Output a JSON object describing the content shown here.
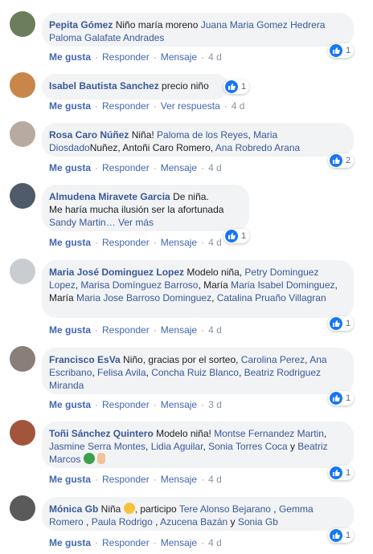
{
  "labels": {
    "like": "Me gusta",
    "reply": "Responder",
    "message": "Mensaje",
    "view_reply": "Ver respuesta",
    "sep": "·"
  },
  "comments": [
    {
      "author": "Pepita Gómez",
      "text": " Niño maría moreno ",
      "tags": [
        "Juana Maria Gomez Hedrera",
        "Paloma Galafate Andrades"
      ],
      "time": "4 d",
      "reactions": "1",
      "avatar_color": "#6b7d5a"
    },
    {
      "author": "Isabel Bautista Sanchez",
      "text": " precio niño",
      "time": "4 d",
      "reactions": "1",
      "avatar_color": "#c8864a"
    },
    {
      "author": "Rosa Caro Núñez",
      "text_a": " Niña! ",
      "tag_a": "Paloma de los Reyes",
      "text_b": ", ",
      "tag_b": "Maria Diosdado",
      "text_c": "Nuñez, Antoñi Caro Romero, ",
      "tag_c": "Ana Robredo Arana",
      "time": "4 d",
      "reactions": "2",
      "avatar_color": "#b7aaa0"
    },
    {
      "author": "Almudena Miravete Garcia",
      "text": " De niña.",
      "line2": "Me haría mucha ilusión ser la afortunada",
      "tag": "Sandy Martin",
      "more": "… Ver más",
      "time": "4 d",
      "reactions": "1",
      "avatar_color": "#4f5a6a"
    },
    {
      "author": "Maria José Dominguez Lopez",
      "text_a": " Modelo niña, ",
      "tag_a": "Petry Dominguez Lopez",
      "text_b": ", ",
      "tag_b": "Marisa Domínguez Barroso",
      "text_c": ", María ",
      "tag_c": "Maria Isabel Dominguez",
      "text_d": ", María ",
      "tag_d": "Maria Jose Barroso Dominguez",
      "text_e": ", ",
      "tag_e": "Catalina Pruaño Villagran",
      "time": "4 d",
      "reactions": "1",
      "avatar_color": "#c9ccd1"
    },
    {
      "author": "Francisco EsVa",
      "text_a": " Niño, gracias por el sorteo, ",
      "tag_a": "Carolina Perez",
      "text_b": ", ",
      "tag_b": "Ana Escribano",
      "text_c": ", ",
      "tag_c": "Felisa Avila",
      "text_d": ", ",
      "tag_d": "Concha Ruiz Blanco",
      "text_e": ", ",
      "tag_e": "Beatriz Rodriguez Miranda",
      "time": "3 d",
      "reactions": "1",
      "avatar_color": "#8a7f78"
    },
    {
      "author": "Toñi Sánchez Quintero",
      "text_a": " Modelo niña! ",
      "tag_a": "Montse Fernandez Martin",
      "text_b": ", ",
      "tag_b": "Jasmine Serra Montes",
      "text_c": ", ",
      "tag_c": "Lidia Aguilar",
      "text_d": ", ",
      "tag_d": "Sonia Torres Coca",
      "text_e": " y ",
      "tag_e": "Beatriz Marcos",
      "time": "4 d",
      "reactions": "1",
      "avatar_color": "#a2553c"
    },
    {
      "author": "Mónica Gb",
      "text_a": " Niña ",
      "text_b": ", participo ",
      "tag_a": "Tere Alonso Bejarano",
      "text_c": " , ",
      "tag_b": "Gemma Romero",
      "text_d": " , ",
      "tag_c": "Paula Rodrigo",
      "text_e": " , ",
      "tag_d": "Azucena Bazán",
      "text_f": " y ",
      "tag_e": "Sonia Gb",
      "time": "4 d",
      "reactions": "1",
      "avatar_color": "#5a5a5a"
    }
  ]
}
